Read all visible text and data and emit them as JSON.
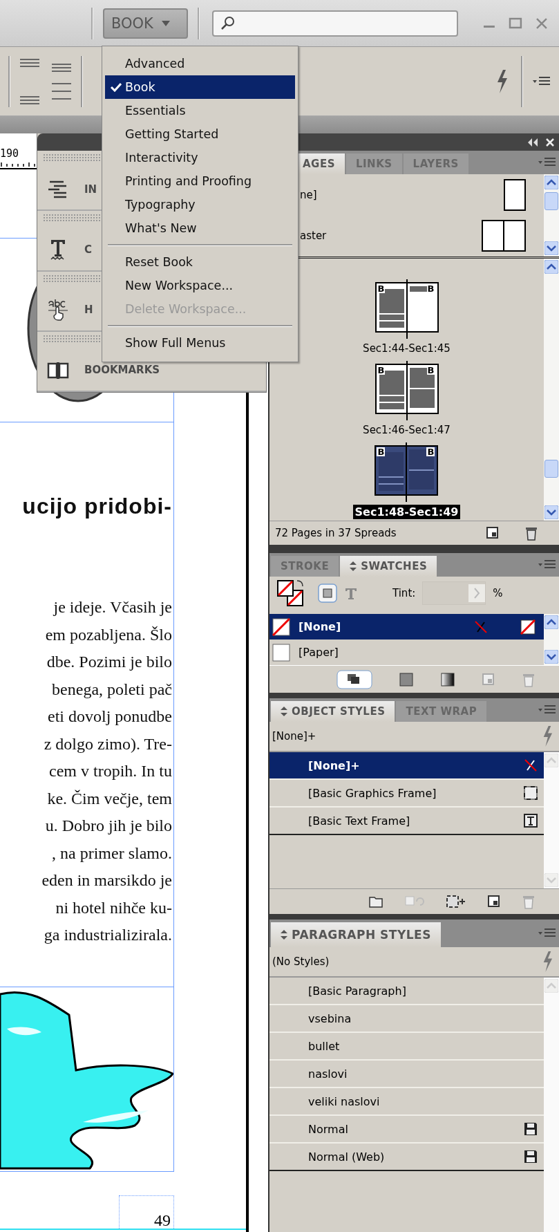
{
  "toolbar": {
    "workspace": "BOOK"
  },
  "workspace_menu": {
    "groups": [
      [
        {
          "label": "Advanced",
          "selected": false,
          "disabled": false
        },
        {
          "label": "Book",
          "selected": true,
          "disabled": false
        },
        {
          "label": "Essentials",
          "selected": false,
          "disabled": false
        },
        {
          "label": "Getting Started",
          "selected": false,
          "disabled": false
        },
        {
          "label": "Interactivity",
          "selected": false,
          "disabled": false
        },
        {
          "label": "Printing and Proofing",
          "selected": false,
          "disabled": false
        },
        {
          "label": "Typography",
          "selected": false,
          "disabled": false
        },
        {
          "label": "What's New",
          "selected": false,
          "disabled": false
        }
      ],
      [
        {
          "label": "Reset Book",
          "selected": false,
          "disabled": false
        },
        {
          "label": "New Workspace...",
          "selected": false,
          "disabled": false
        },
        {
          "label": "Delete Workspace...",
          "selected": false,
          "disabled": true
        }
      ],
      [
        {
          "label": "Show Full Menus",
          "selected": false,
          "disabled": false
        }
      ]
    ]
  },
  "floating_panel": {
    "items": [
      {
        "label": "IN",
        "kind": "index"
      },
      {
        "label": "C",
        "kind": "character"
      },
      {
        "label": "H",
        "kind": "hyperlinks"
      },
      {
        "label": "BOOKMARKS",
        "kind": "bookmarks"
      }
    ]
  },
  "document": {
    "ruler": "190",
    "heading": "ucijo pridobi-",
    "lines": [
      "je ideje. Včasih je",
      "em pozabljena. Šlo",
      "dbe. Pozimi je bilo",
      "benega, poleti pač",
      "eti dovolj ponudbe",
      "z dolgo zimo). Tre-",
      "cem v tropih. In tu",
      "ke. Čim večje, tem",
      "u. Dobro jih je bilo",
      ", na primer slamo.",
      "eden in marsikdo je",
      "ni hotel nihče ku-",
      "ga industrializirala."
    ],
    "page_number": "49"
  },
  "pages_panel": {
    "tabs": [
      {
        "label": "AGES",
        "selected": true
      },
      {
        "label": "LINKS",
        "selected": false
      },
      {
        "label": "LAYERS",
        "selected": false
      }
    ],
    "masters": [
      {
        "label": "ne]",
        "kind": "single"
      },
      {
        "label": "aster",
        "kind": "spread"
      }
    ],
    "spreads": [
      {
        "label": "Sec1:44-Sec1:45",
        "selected": false,
        "left_master": "B",
        "right_master": "B"
      },
      {
        "label": "Sec1:46-Sec1:47",
        "selected": false,
        "left_master": "B",
        "right_master": "B"
      },
      {
        "label": "Sec1:48-Sec1:49",
        "selected": true,
        "left_master": "B",
        "right_master": "B"
      }
    ],
    "footer": "72 Pages in 37 Spreads"
  },
  "swatches_panel": {
    "tabs": [
      {
        "label": "STROKE",
        "selected": false
      },
      {
        "label": "SWATCHES",
        "selected": true
      }
    ],
    "tint_label": "Tint:",
    "tint_unit": "%",
    "swatches": [
      {
        "name": "[None]",
        "kind": "none",
        "selected": true
      },
      {
        "name": "[Paper]",
        "kind": "paper",
        "selected": false
      }
    ]
  },
  "object_styles_panel": {
    "tabs": [
      {
        "label": "OBJECT STYLES",
        "selected": true
      },
      {
        "label": "TEXT WRAP",
        "selected": false
      }
    ],
    "current": "[None]+",
    "styles": [
      {
        "name": "[None]+",
        "kind": "none",
        "selected": true
      },
      {
        "name": "[Basic Graphics Frame]",
        "kind": "graphics",
        "selected": false
      },
      {
        "name": "[Basic Text Frame]",
        "kind": "text",
        "selected": false
      }
    ]
  },
  "paragraph_styles_panel": {
    "tabs": [
      {
        "label": "PARAGRAPH STYLES",
        "selected": true
      }
    ],
    "current": "(No Styles)",
    "styles": [
      {
        "name": "[Basic Paragraph]",
        "kind": "plain",
        "selected": false
      },
      {
        "name": "vsebina",
        "kind": "plain",
        "selected": false
      },
      {
        "name": "bullet",
        "kind": "plain",
        "selected": false
      },
      {
        "name": "naslovi",
        "kind": "plain",
        "selected": false
      },
      {
        "name": "veliki naslovi",
        "kind": "plain",
        "selected": false
      },
      {
        "name": "Normal",
        "kind": "imported",
        "selected": false
      },
      {
        "name": "Normal (Web)",
        "kind": "imported",
        "selected": false
      }
    ]
  }
}
